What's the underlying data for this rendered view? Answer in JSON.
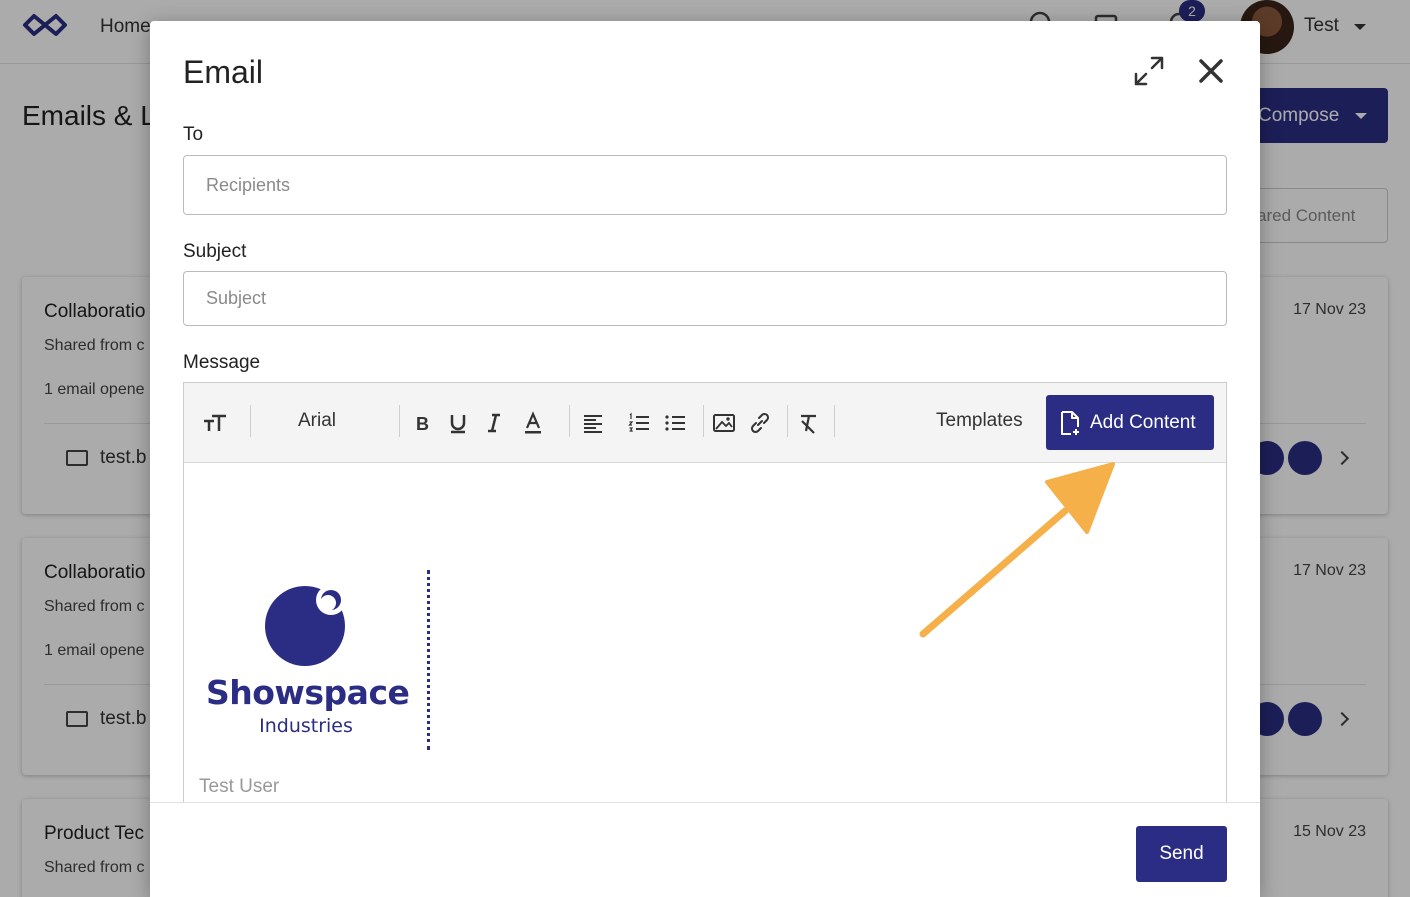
{
  "nav": {
    "home_label": "Home",
    "notification_count": "2",
    "user_name": "Test"
  },
  "page": {
    "title": "Emails & Li",
    "compose_label": "Compose",
    "filter_label": "ared Content"
  },
  "cards": [
    {
      "title": "Collaboratio",
      "subtitle": "Shared from c",
      "opened": "1 email opene",
      "email": "test.b",
      "date": "17 Nov 23"
    },
    {
      "title": "Collaboratio",
      "subtitle": "Shared from c",
      "opened": "1 email opene",
      "email": "test.b",
      "date": "17 Nov 23"
    },
    {
      "title": "Product Tec",
      "subtitle": "Shared from c",
      "date": "15 Nov 23"
    }
  ],
  "modal": {
    "title": "Email",
    "to_label": "To",
    "to_placeholder": "Recipients",
    "subject_label": "Subject",
    "subject_placeholder": "Subject",
    "message_label": "Message",
    "toolbar": {
      "font_name": "Arial",
      "templates_label": "Templates",
      "add_content_label": "Add Content"
    },
    "signature": {
      "brand": "Showspace",
      "tagline": "Industries",
      "name": "Test User"
    },
    "send_label": "Send"
  },
  "colors": {
    "brand": "#2b2d84",
    "arrow": "#f5b04a"
  },
  "icons": {
    "expand": "expand-icon",
    "close": "close-icon",
    "text-size": "text-size-icon",
    "bold": "bold-icon",
    "underline": "underline-icon",
    "italic": "italic-icon",
    "font-color": "font-color-icon",
    "align-left": "align-left-icon",
    "ordered-list": "ordered-list-icon",
    "bullet-list": "bullet-list-icon",
    "image": "image-icon",
    "link": "link-icon",
    "clear-format": "clear-format-icon",
    "add-file": "add-file-icon"
  }
}
